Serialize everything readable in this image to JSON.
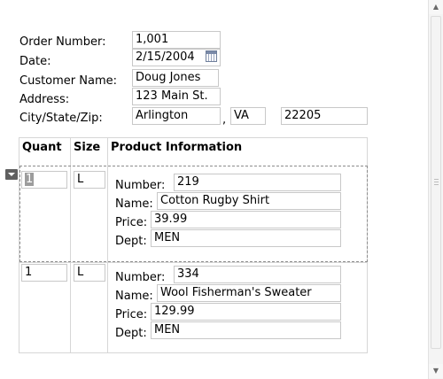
{
  "header": {
    "order_number_label": "Order Number:",
    "order_number": "1,001",
    "date_label": "Date:",
    "date": "2/15/2004",
    "customer_name_label": "Customer Name:",
    "customer_name": "Doug Jones",
    "address_label": "Address:",
    "address": "123 Main St.",
    "city_state_zip_label": "City/State/Zip:",
    "city": "Arlington",
    "comma": ",",
    "state": "VA",
    "zip": "22205"
  },
  "table": {
    "columns": [
      "Quant",
      "Size",
      "Product Information"
    ],
    "number_label": "Number:",
    "name_label": "Name:",
    "price_label": "Price:",
    "dept_label": "Dept:",
    "rows": [
      {
        "quant": "1",
        "size": "L",
        "number": "219",
        "name": "Cotton Rugby Shirt",
        "price": "39.99",
        "dept": "MEN"
      },
      {
        "quant": "1",
        "size": "L",
        "number": "334",
        "name": "Wool Fisherman's Sweater",
        "price": "129.99",
        "dept": "MEN"
      }
    ]
  },
  "icons": {
    "calendar": "calendar-icon",
    "row_menu": "dropdown-menu-icon",
    "scroll_up": "scroll-up-arrow-icon",
    "scroll_down": "scroll-down-arrow-icon"
  },
  "colors": {
    "border": "#c8c8c8",
    "grid": "#d6d6d6",
    "selection_highlight": "#9c9c9c"
  }
}
